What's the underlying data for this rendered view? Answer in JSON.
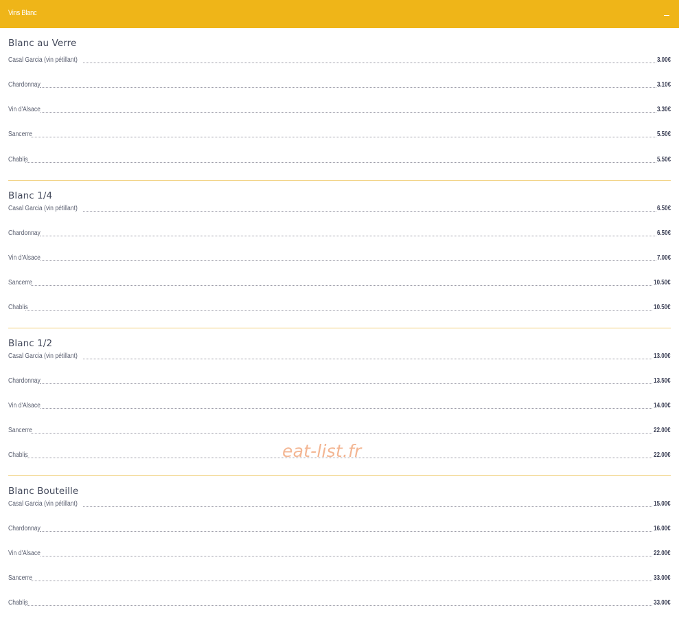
{
  "header": {
    "title": "Vins Blanc",
    "toggle_icon": "minus-icon"
  },
  "colors": {
    "accent": "#efb518",
    "divider": "#f0cf7a",
    "watermark": "#f3b08a"
  },
  "sections": [
    {
      "title": "Blanc au Verre",
      "items": [
        {
          "name": "Casal Garcia (vin pétillant)",
          "price": "3.00€"
        },
        {
          "name": "Chardonnay",
          "price": "3.10€"
        },
        {
          "name": "Vin d'Alsace",
          "price": "3.30€"
        },
        {
          "name": "Sancerre",
          "price": "5.50€"
        },
        {
          "name": "Chablis",
          "price": "5.50€"
        }
      ]
    },
    {
      "title": "Blanc 1/4",
      "items": [
        {
          "name": "Casal Garcia (vin pétillant)",
          "price": "6.50€"
        },
        {
          "name": "Chardonnay",
          "price": "6.50€"
        },
        {
          "name": "Vin d'Alsace",
          "price": "7.00€"
        },
        {
          "name": "Sancerre",
          "price": "10.50€"
        },
        {
          "name": "Chablis",
          "price": "10.50€"
        }
      ]
    },
    {
      "title": "Blanc 1/2",
      "items": [
        {
          "name": "Casal Garcia (vin pétillant)",
          "price": "13.00€"
        },
        {
          "name": "Chardonnay",
          "price": "13.50€"
        },
        {
          "name": "Vin d'Alsace",
          "price": "14.00€"
        },
        {
          "name": "Sancerre",
          "price": "22.00€"
        },
        {
          "name": "Chablis",
          "price": "22.00€"
        }
      ]
    },
    {
      "title": "Blanc Bouteille",
      "items": [
        {
          "name": "Casal Garcia (vin pétillant)",
          "price": "15.00€"
        },
        {
          "name": "Chardonnay",
          "price": "16.00€"
        },
        {
          "name": "Vin d'Alsace",
          "price": "22.00€"
        },
        {
          "name": "Sancerre",
          "price": "33.00€"
        },
        {
          "name": "Chablis",
          "price": "33.00€"
        }
      ]
    }
  ],
  "watermark": "eat-list.fr"
}
